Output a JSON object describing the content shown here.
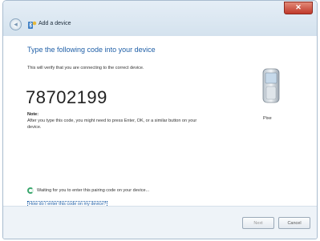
{
  "window": {
    "title": "Add a device",
    "close_glyph": "✕",
    "back_glyph": "◂"
  },
  "content": {
    "heading": "Type the following code into your device",
    "subtext": "This will verify that you are connecting to the correct device.",
    "pairing_code": "78702199",
    "note_label": "Note:",
    "note_text": "After you type this code, you might need to press Enter, OK, or a similar button on your device.",
    "device_name": "Pixe",
    "status_text": "Waiting for you to enter this pairing code on your device...",
    "help_link": "How do I enter this code on my device?"
  },
  "footer": {
    "next_label": "Next",
    "cancel_label": "Cancel"
  },
  "icons": {
    "back": "back-arrow-icon",
    "bluetooth": "bluetooth-add-device-icon",
    "phone": "mobile-phone-icon",
    "status": "progress-spinner-icon",
    "close": "close-icon"
  },
  "colors": {
    "heading": "#1f5fa7",
    "close_button": "#c0392b",
    "status": "#3aa76d"
  }
}
